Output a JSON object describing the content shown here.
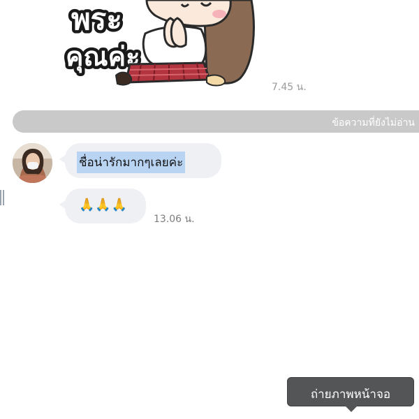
{
  "sticker": {
    "text_line1": "พระ",
    "text_line2": "คุณค่ะ",
    "time": "7.45 น."
  },
  "divider": {
    "unread_label": "ข้อความที่ยังไม่อ่าน"
  },
  "messages": [
    {
      "text": "ชื่อน่ารักมากๆเลยค่ะ",
      "selected": true
    },
    {
      "text": "🙏🙏🙏",
      "time": "13.06 น."
    }
  ],
  "tooltip": {
    "label": "ถ่ายภาพหน้าจอ"
  },
  "colors": {
    "bubble": "#eef0f4",
    "selection": "#b9d3f2",
    "unread_bar": "#c9c9c9",
    "tooltip_bg": "#545557"
  },
  "icons": {
    "sticker": "praying-girl-sticker",
    "avatar": "user-avatar-photo",
    "edge": "drag-handle"
  }
}
